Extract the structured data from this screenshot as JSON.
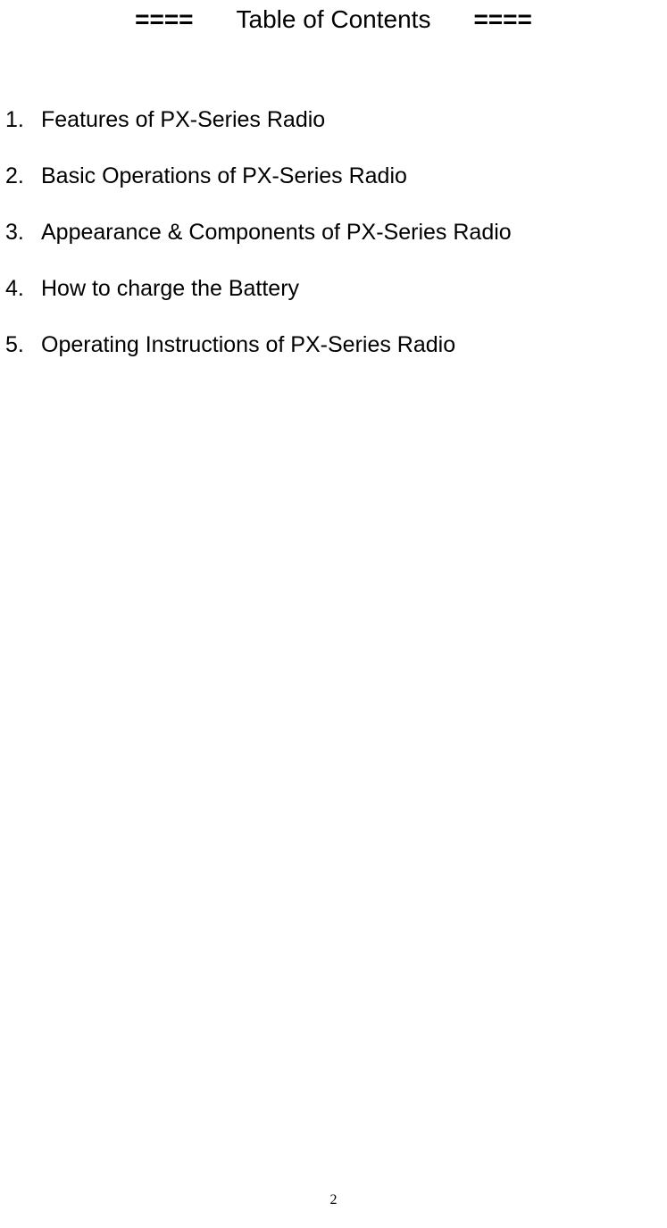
{
  "title": {
    "decoration_left": "====",
    "text": "Table of Contents",
    "decoration_right": "===="
  },
  "toc": [
    {
      "number": "1.",
      "text": "Features of PX-Series Radio"
    },
    {
      "number": "2.",
      "text": "Basic Operations of PX-Series Radio"
    },
    {
      "number": "3.",
      "text": "Appearance & Components of PX-Series Radio"
    },
    {
      "number": "4.",
      "text": "How to charge the Battery"
    },
    {
      "number": "5.",
      "text": "Operating Instructions of PX-Series Radio"
    }
  ],
  "page_number": "2"
}
